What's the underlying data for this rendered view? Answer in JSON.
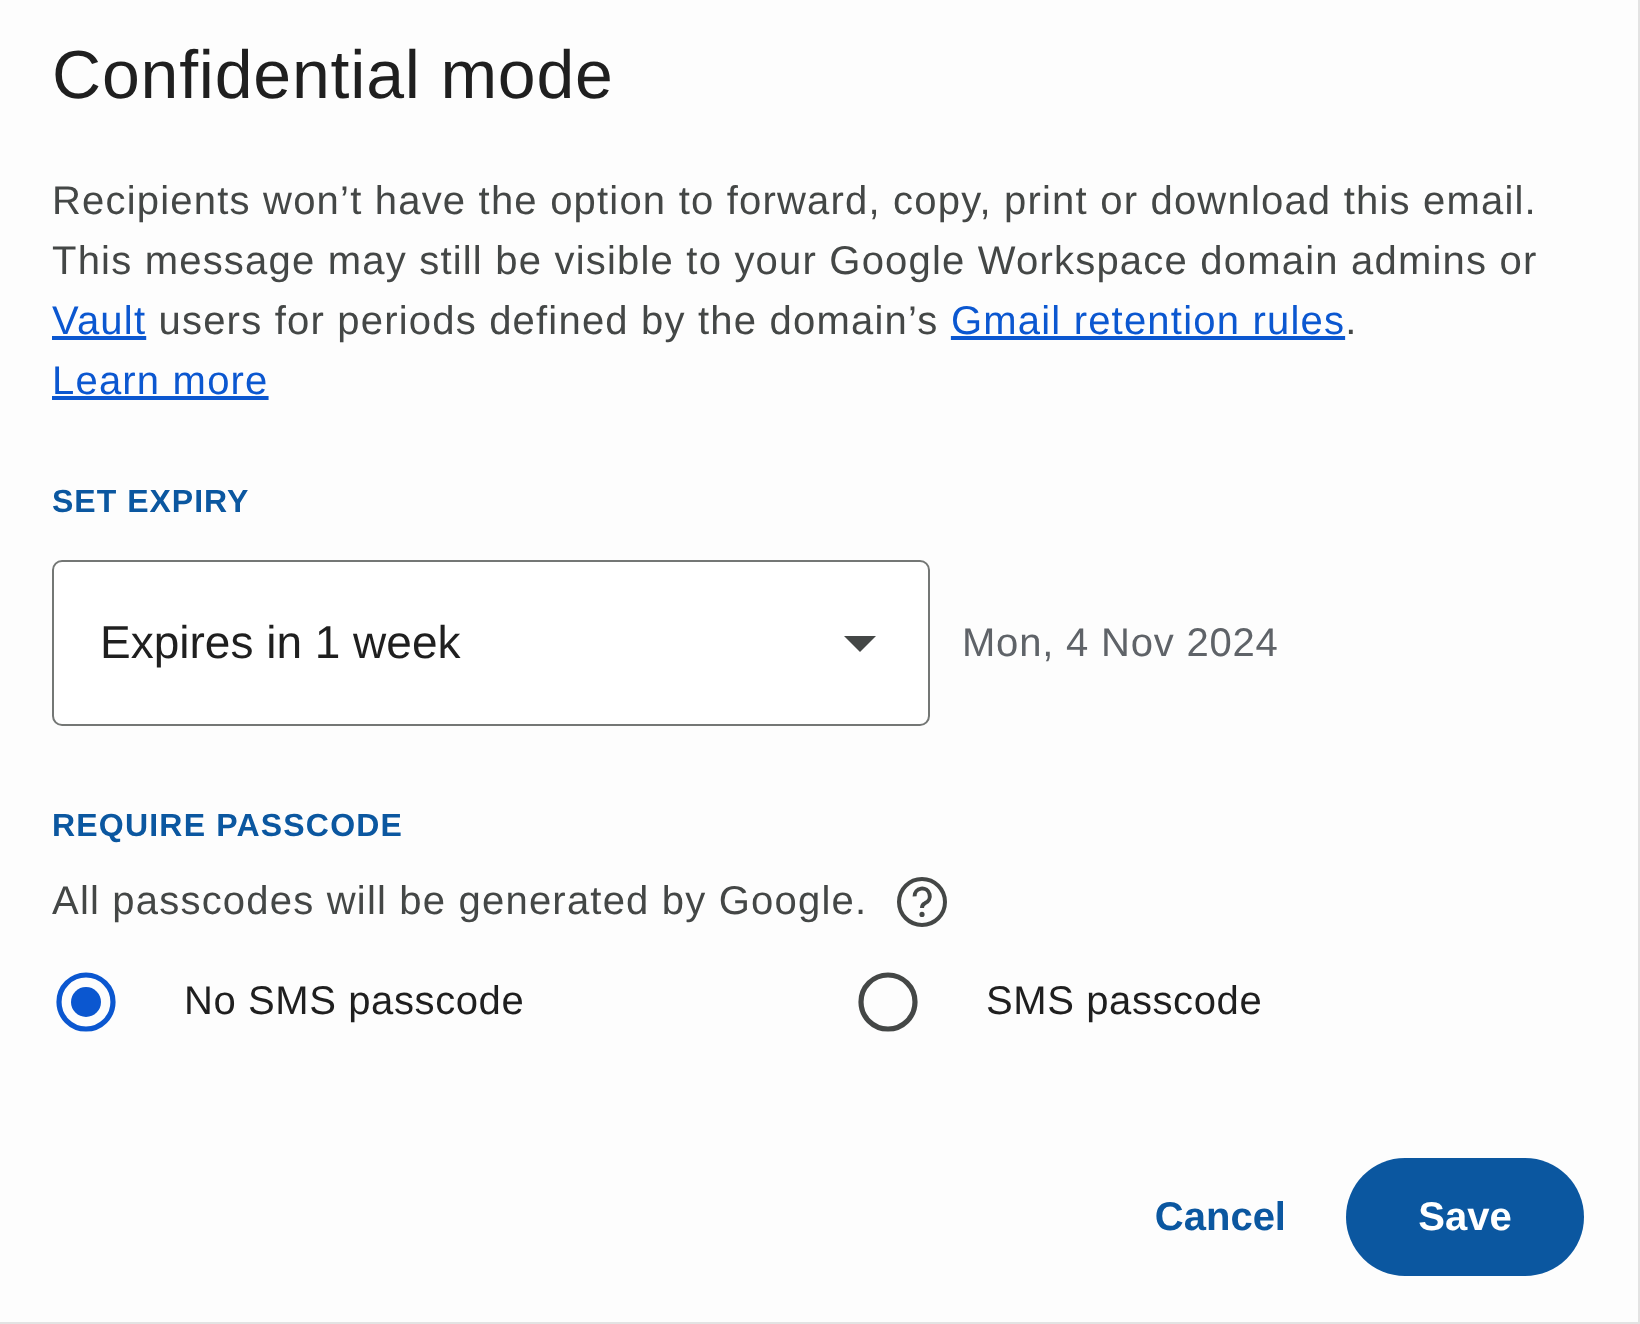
{
  "dialog": {
    "title": "Confidential mode",
    "description": [
      {
        "kind": "text",
        "text": "Recipients won’t have the option to forward, copy, print or download this email. This message may still be visible to your Google Workspace domain admins or "
      },
      {
        "kind": "link",
        "text": "Vault"
      },
      {
        "kind": "text",
        "text": " users for periods defined by the domain’s "
      },
      {
        "kind": "link",
        "text": "Gmail retention rules"
      },
      {
        "kind": "text",
        "text": ". "
      },
      {
        "kind": "link",
        "text": "Learn more"
      }
    ]
  },
  "expiry": {
    "label": "SET EXPIRY",
    "dropdown": {
      "value": "Expires in 1 week"
    },
    "date": "Mon, 4 Nov 2024"
  },
  "passcode": {
    "label": "REQUIRE PASSCODE",
    "note": "All passcodes will be generated by Google.",
    "options": [
      {
        "label": "No SMS passcode",
        "selected": true
      },
      {
        "label": "SMS passcode",
        "selected": false
      }
    ]
  },
  "buttons": [
    {
      "label": "Cancel",
      "kind": "text"
    },
    {
      "label": "Save",
      "kind": "filled"
    }
  ]
}
